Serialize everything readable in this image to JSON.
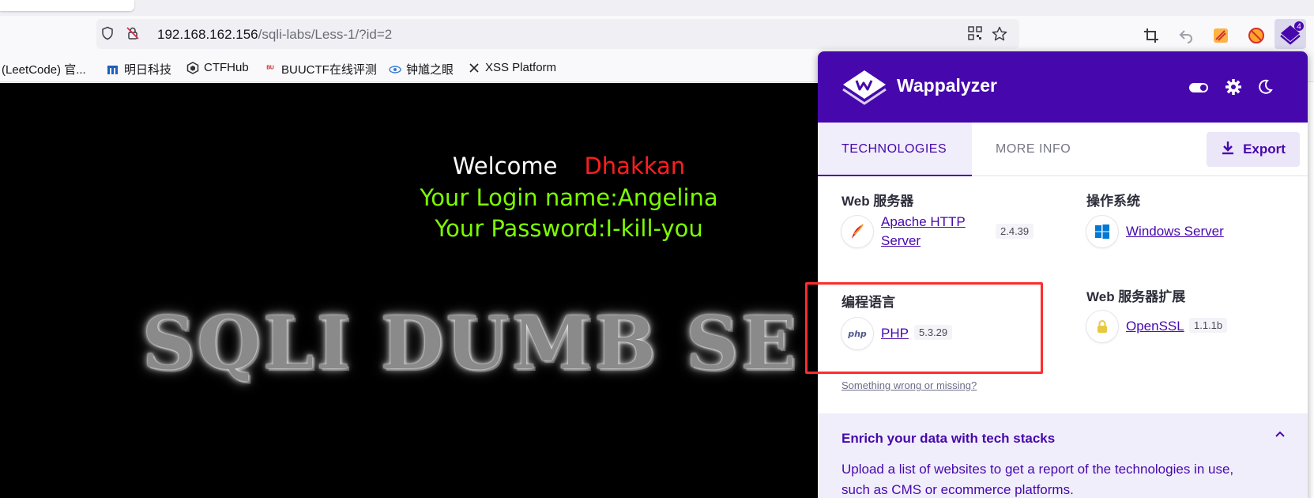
{
  "browser": {
    "url_host": "192.168.162.156",
    "url_path": "/sqli-labs/Less-1/?id=2",
    "extension_badge": "4",
    "bookmarks": [
      {
        "label": "(LeetCode) 官..."
      },
      {
        "label": "明日科技"
      },
      {
        "label": "CTFHub"
      },
      {
        "label": "BUUCTF在线评测"
      },
      {
        "label": "钟馗之眼"
      },
      {
        "label": "XSS Platform"
      }
    ]
  },
  "page": {
    "welcome": "Welcome",
    "user": "Dhakkan",
    "login_name": "Your Login name:Angelina",
    "password": "Your Password:I-kill-you",
    "banner": "SQLI DUMB SE"
  },
  "wappalyzer": {
    "title": "Wappalyzer",
    "tabs": [
      {
        "label": "TECHNOLOGIES",
        "active": true
      },
      {
        "label": "MORE INFO",
        "active": false
      }
    ],
    "export_label": "Export",
    "categories": [
      {
        "title": "Web 服务器",
        "tech": {
          "name_line1": "Apache HTTP",
          "name_line2": "Server",
          "version": "2.4.39",
          "icon": "apache-feather-icon"
        }
      },
      {
        "title": "操作系统",
        "tech": {
          "name": "Windows Server",
          "version": "",
          "icon": "windows-icon"
        }
      },
      {
        "title": "编程语言",
        "tech": {
          "name": "PHP",
          "version": "5.3.29",
          "icon": "php-icon"
        }
      },
      {
        "title": "Web 服务器扩展",
        "tech": {
          "name": "OpenSSL",
          "version": "1.1.1b",
          "icon": "lock-icon"
        }
      }
    ],
    "php_icon_text": "php",
    "feedback_link": "Something wrong or missing?",
    "enrich": {
      "title": "Enrich your data with tech stacks",
      "text": "Upload a list of websites to get a report of the technologies in use, such as CMS or ecommerce platforms."
    }
  },
  "colors": {
    "wappalyzer_purple": "#4608ad",
    "highlight_red": "#ff2d2d",
    "login_green": "#7cfc00",
    "user_red": "#ff1e1e"
  }
}
